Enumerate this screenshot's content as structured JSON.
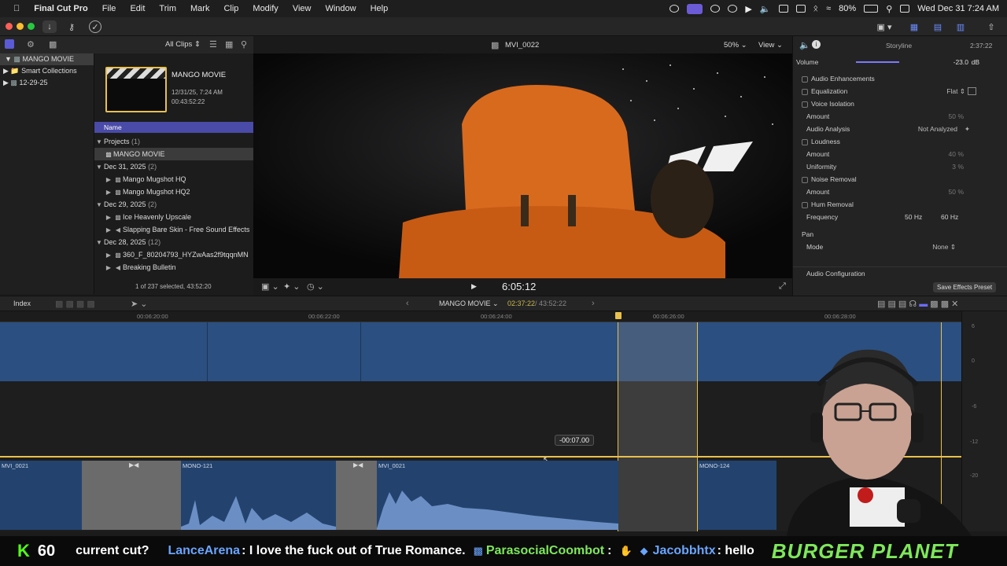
{
  "menubar": {
    "app": "Final Cut Pro",
    "items": [
      "File",
      "Edit",
      "Trim",
      "Mark",
      "Clip",
      "Modify",
      "View",
      "Window",
      "Help"
    ],
    "battery": "80%",
    "datetime": "Wed Dec 31  7:24 AM"
  },
  "library": {
    "all_clips": "All Clips",
    "items": [
      {
        "label": "MANGO MOVIE",
        "selected": true
      },
      {
        "label": "Smart Collections",
        "selected": false
      },
      {
        "label": "12-29-25",
        "selected": false
      }
    ]
  },
  "browser": {
    "project_title": "MANGO MOVIE",
    "project_date": "12/31/25, 7:24 AM",
    "project_duration": "00:43:52:22",
    "column_name": "Name",
    "rows": [
      {
        "kind": "group",
        "label": "Projects",
        "count": "(1)"
      },
      {
        "kind": "item",
        "label": "MANGO MOVIE",
        "selected": true
      },
      {
        "kind": "group",
        "label": "Dec 31, 2025",
        "count": "(2)"
      },
      {
        "kind": "item",
        "label": "Mango Mugshot HQ"
      },
      {
        "kind": "item",
        "label": "Mango Mugshot HQ2"
      },
      {
        "kind": "group",
        "label": "Dec 29, 2025",
        "count": "(2)"
      },
      {
        "kind": "item",
        "label": "Ice Heavenly Upscale"
      },
      {
        "kind": "item",
        "label": "Slapping Bare Skin - Free Sound Effects"
      },
      {
        "kind": "group",
        "label": "Dec 28, 2025",
        "count": "(12)"
      },
      {
        "kind": "item",
        "label": "360_F_80204793_HYZwAas2f9tqqnMN"
      },
      {
        "kind": "item",
        "label": "Breaking Bulletin"
      }
    ],
    "status": "1 of 237 selected, 43:52:20"
  },
  "viewer": {
    "clip_name": "MVI_0022",
    "zoom": "50%",
    "view_label": "View",
    "timecode": "6:05:12"
  },
  "inspector": {
    "title": "Storyline",
    "duration": "2:37:22",
    "volume_label": "Volume",
    "volume_value": "-23.0",
    "volume_unit": "dB",
    "audio_enh": "Audio Enhancements",
    "equalization": "Equalization",
    "eq_value": "Flat",
    "voice_isolation": "Voice Isolation",
    "amount": "Amount",
    "vi_amount": "50",
    "audio_analysis": "Audio Analysis",
    "analysis_value": "Not Analyzed",
    "loudness": "Loudness",
    "loud_amount": "40",
    "uniformity": "Uniformity",
    "uniformity_value": "3",
    "noise_removal": "Noise Removal",
    "nr_amount": "50",
    "hum_removal": "Hum Removal",
    "frequency": "Frequency",
    "freq_50": "50 Hz",
    "freq_60": "60 Hz",
    "pan": "Pan",
    "mode": "Mode",
    "mode_value": "None",
    "audio_config": "Audio Configuration",
    "save_preset": "Save Effects Preset",
    "percent": "%"
  },
  "timeline": {
    "index": "Index",
    "project": "MANGO MOVIE",
    "position": "02:37:22",
    "total": "/ 43:52:22",
    "ticks": [
      "00:06:20:00",
      "00:06:22:00",
      "00:06:24:00",
      "00:06:26:00",
      "00:06:28:00"
    ],
    "offset_tooltip": "-00:07.00",
    "clips": [
      "MVI_0021",
      "MONO-121",
      "MVI_0021",
      "MONO-124"
    ],
    "meter_labels": [
      "6",
      "0",
      "-6",
      "-12",
      "-20"
    ]
  },
  "chat": {
    "viewers": "60",
    "fragment": "current cut?",
    "user1": "LanceArena",
    "msg1": ": I love the fuck out of True Romance.",
    "user2": "ParasocialCoombot",
    "sep2": ":",
    "user3": "Jacobbhtx",
    "msg3": ": hello",
    "brand": "BURGER PLANET"
  },
  "colors": {
    "accent": "#e9c04c",
    "clip_blue": "#23436e",
    "select_purple": "#5b5bd6",
    "chat_green": "#7ee85a",
    "chat_blue": "#6aa5ff",
    "seat_orange": "#d86a1e"
  }
}
